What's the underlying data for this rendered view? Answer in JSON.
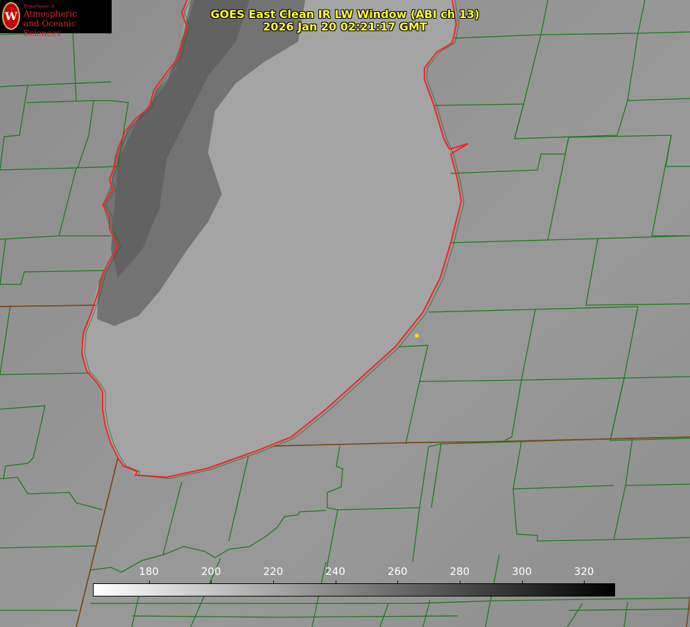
{
  "title": {
    "line1": "GOES East Clean IR LW Window (ABI ch 13)",
    "line2": "2026 Jan 20 02:21:17 GMT"
  },
  "logo": {
    "department": "Department of",
    "line1": "Atmospheric",
    "line2": "and Oceanic Sciences",
    "seal_letter": "W"
  },
  "colorbar": {
    "ticks": [
      "180",
      "200",
      "220",
      "240",
      "260",
      "280",
      "300",
      "320"
    ],
    "tick_values": [
      180,
      200,
      220,
      240,
      260,
      280,
      300,
      320
    ],
    "min": 162,
    "max": 330,
    "low_color": "#ffffff",
    "high_color": "#000000"
  },
  "colors": {
    "background": "#8a8a8a",
    "county_lines": "#1a7a1a",
    "lake_outline": "#ff2020",
    "state_lines": "#8b4513",
    "title": "#ffff33"
  }
}
